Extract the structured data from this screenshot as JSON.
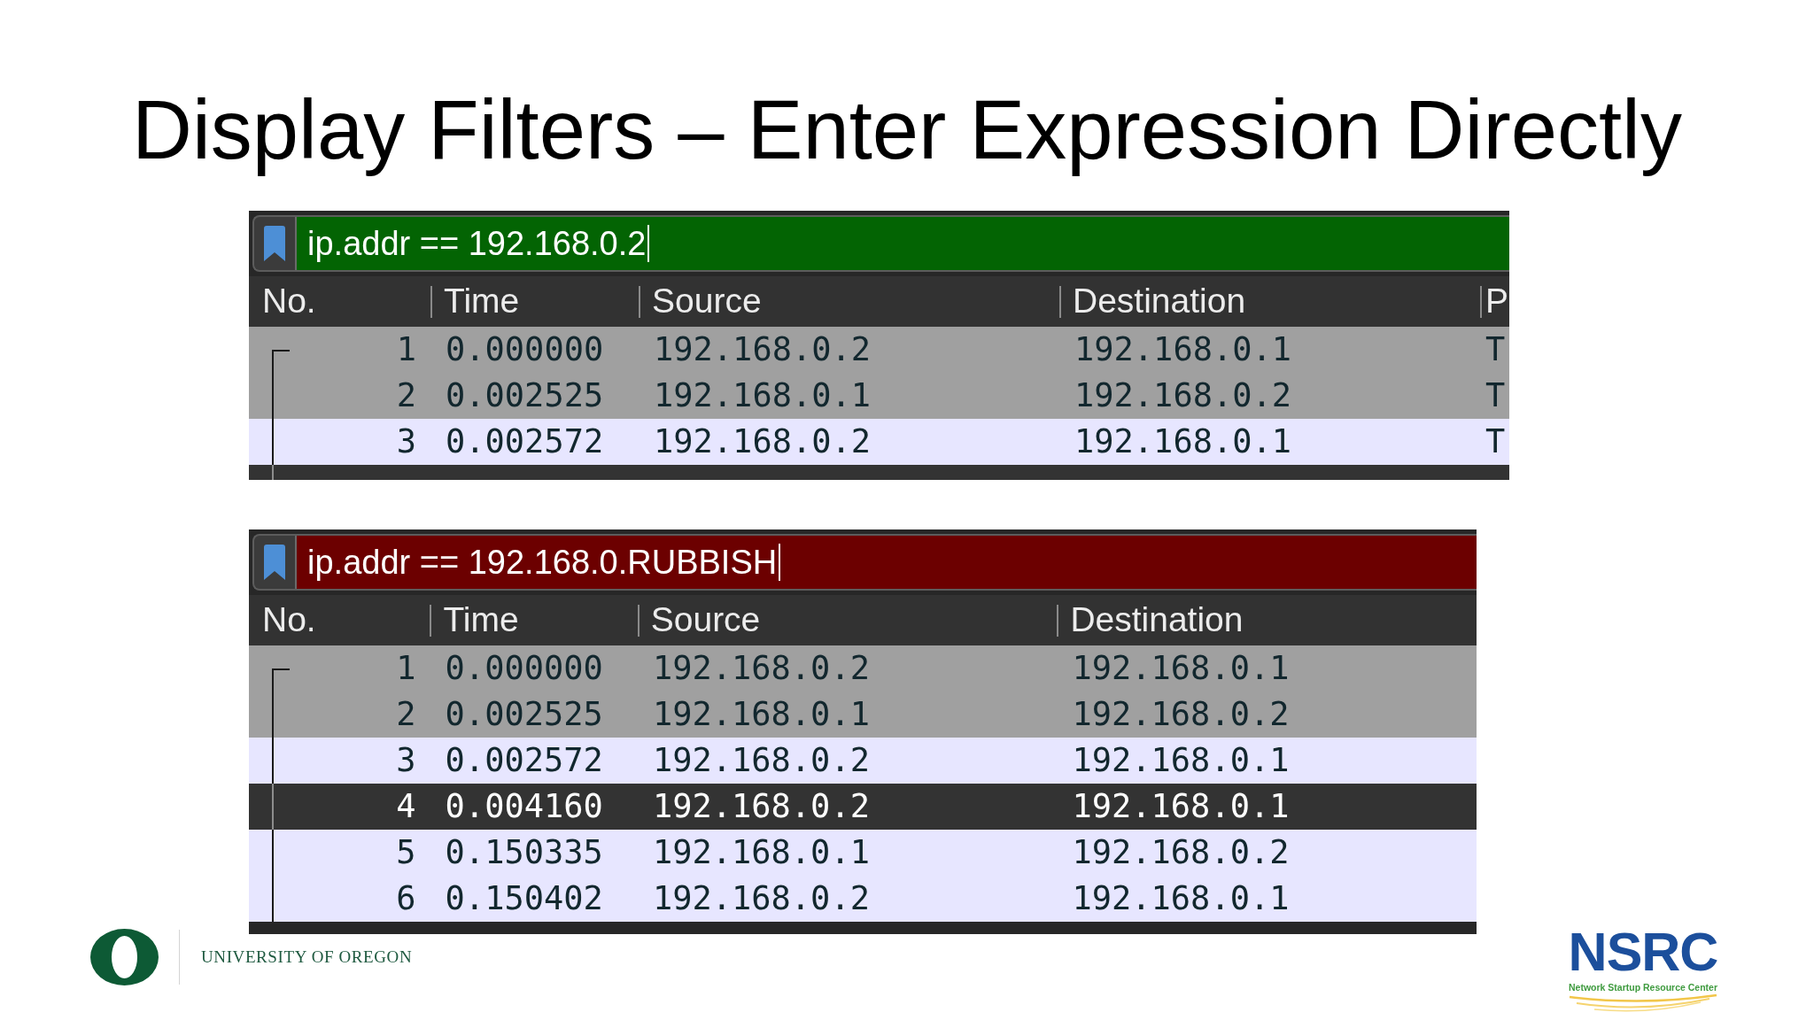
{
  "title": "Display Filters – Enter Expression Directly",
  "examples": [
    {
      "filter": {
        "value": "ip.addr == 192.168.0.2",
        "valid": true
      },
      "columns": [
        "No.",
        "Time",
        "Source",
        "Destination",
        "P"
      ],
      "rows": [
        {
          "cells": [
            "1",
            "0.000000",
            "192.168.0.2",
            "192.168.0.1",
            "T"
          ],
          "selected": false,
          "color": "#a0a0a0"
        },
        {
          "cells": [
            "2",
            "0.002525",
            "192.168.0.1",
            "192.168.0.2",
            "T"
          ],
          "selected": false,
          "color": "#a0a0a0"
        },
        {
          "cells": [
            "3",
            "0.002572",
            "192.168.0.2",
            "192.168.0.1",
            "T"
          ],
          "selected": false,
          "color": "#e7e6ff"
        },
        {
          "selected": true
        }
      ]
    },
    {
      "filter": {
        "value": "ip.addr == 192.168.0.RUBBISH",
        "valid": false
      },
      "columns": [
        "No.",
        "Time",
        "Source",
        "Destination"
      ],
      "rows": [
        {
          "cells": [
            "1",
            "0.000000",
            "192.168.0.2",
            "192.168.0.1"
          ],
          "selected": false,
          "color": "#a0a0a0"
        },
        {
          "cells": [
            "2",
            "0.002525",
            "192.168.0.1",
            "192.168.0.2"
          ],
          "selected": false,
          "color": "#a0a0a0"
        },
        {
          "cells": [
            "3",
            "0.002572",
            "192.168.0.2",
            "192.168.0.1"
          ],
          "selected": false,
          "color": "#e7e6ff"
        },
        {
          "cells": [
            "4",
            "0.004160",
            "192.168.0.2",
            "192.168.0.1"
          ],
          "selected": true
        },
        {
          "cells": [
            "5",
            "0.150335",
            "192.168.0.1",
            "192.168.0.2"
          ],
          "selected": false,
          "color": "#e7e6ff"
        },
        {
          "cells": [
            "6",
            "0.150402",
            "192.168.0.2",
            "192.168.0.1"
          ],
          "selected": false,
          "color": "#e7e6ff"
        }
      ]
    }
  ],
  "footer": {
    "university": "UNIVERSITY OF OREGON",
    "logo_text": "NSRC",
    "logo_tagline": "Network Startup Resource Center"
  }
}
